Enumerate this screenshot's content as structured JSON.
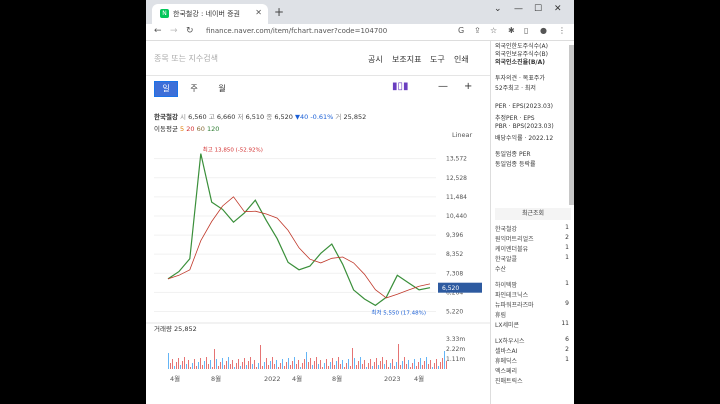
{
  "browser": {
    "tab_title": "한국철강 : 네이버 증권",
    "url": "finance.naver.com/item/fchart.naver?code=104700"
  },
  "toolbar": {
    "search_placeholder": "종목 또는 지수검색",
    "menu": [
      "공시",
      "보조지표",
      "도구",
      "인쇄"
    ]
  },
  "periods": [
    "일",
    "주",
    "월"
  ],
  "stock": {
    "name": "한국철강",
    "open_label": "시",
    "open": "6,560",
    "high_label": "고",
    "high": "6,660",
    "low_label": "저",
    "low": "6,510",
    "close_label": "종",
    "close": "6,520",
    "change": "▼40 -0.61%",
    "volume_label": "거",
    "volume": "25,852"
  },
  "moving_avg": {
    "label": "이동평균",
    "periods": [
      "5",
      "20",
      "60",
      "120"
    ]
  },
  "scale_label": "Linear",
  "chart_data": {
    "type": "line",
    "y_ticks": [
      13572,
      12528,
      11484,
      10440,
      9396,
      8352,
      7308,
      6264,
      5220
    ],
    "current_price": "6,520",
    "max_label": "최고 13,850 (-52.92%)",
    "min_label": "최저 5,550 (17.48%)",
    "volume_title": "거래량",
    "volume_value": "25,852",
    "volume_ticks": [
      "3.33m",
      "2.22m",
      "1.11m"
    ],
    "x_ticks": [
      "4월",
      "8월",
      "2022",
      "4월",
      "8월",
      "2023",
      "4월"
    ],
    "series": [
      {
        "values": [
          7000,
          7400,
          8100,
          13850,
          11200,
          10800,
          10100,
          10600,
          11300,
          10200,
          9200,
          7900,
          7500,
          7700,
          8400,
          8900,
          7800,
          6400,
          5900,
          5550,
          6000,
          7200,
          6800,
          6400,
          6520
        ]
      }
    ]
  },
  "sidebar": {
    "top_items": [
      "외국인한도주식수(A)",
      "외국인보유주식수(B)",
      "외국인소진율(B/A)"
    ],
    "info_items": [
      "투자의견 · 목표주가",
      "52주최고 · 최저",
      "PER · EPS(2023.03)",
      "추정PER · EPS",
      "PBR · BPS(2023.03)",
      "배당수익률 · 2022.12"
    ],
    "same_industry": [
      "동일업종 PER",
      "동일업종 등락률"
    ],
    "recent_title": "최근조회",
    "recent": [
      {
        "name": "한국철강",
        "count": "1"
      },
      {
        "name": "원익머트리얼즈",
        "count": "2"
      },
      {
        "name": "케이엔더블유",
        "count": "1"
      },
      {
        "name": "한국알콜",
        "count": "1"
      },
      {
        "name": "수산",
        "count": ""
      },
      {
        "name": "하이텍팜",
        "count": "1"
      },
      {
        "name": "파인테크닉스",
        "count": ""
      },
      {
        "name": "뉴파워프라즈마",
        "count": "9"
      },
      {
        "name": "휴림",
        "count": ""
      },
      {
        "name": "LX세미콘",
        "count": "11"
      },
      {
        "name": "LX하우시스",
        "count": "6"
      },
      {
        "name": "셀바스AI",
        "count": "2"
      },
      {
        "name": "휴메딕스",
        "count": "1"
      },
      {
        "name": "엑스페리",
        "count": ""
      },
      {
        "name": "진매트릭스",
        "count": ""
      }
    ]
  }
}
